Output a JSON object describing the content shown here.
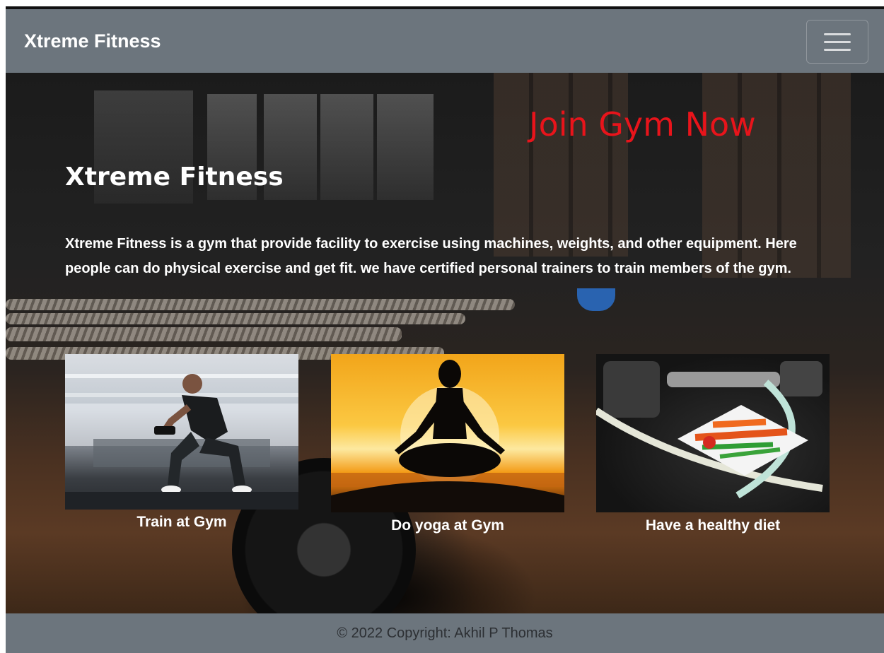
{
  "navbar": {
    "brand": "Xtreme Fitness",
    "toggler_icon": "hamburger-icon"
  },
  "hero": {
    "cta": "Join Gym Now",
    "title": "Xtreme Fitness",
    "description": "Xtreme Fitness is a gym that provide facility to exercise using machines, weights, and other equipment. Here people can do physical exercise and get fit. we have certified personal trainers to train members of the gym."
  },
  "cards": [
    {
      "caption": "Train at Gym"
    },
    {
      "caption": "Do yoga at Gym"
    },
    {
      "caption": "Have a healthy diet"
    }
  ],
  "footer": {
    "copyright": "© 2022 Copyright: Akhil P Thomas"
  },
  "colors": {
    "navbar": "#6c757d",
    "cta": "#e8141b",
    "text": "#ffffff"
  }
}
